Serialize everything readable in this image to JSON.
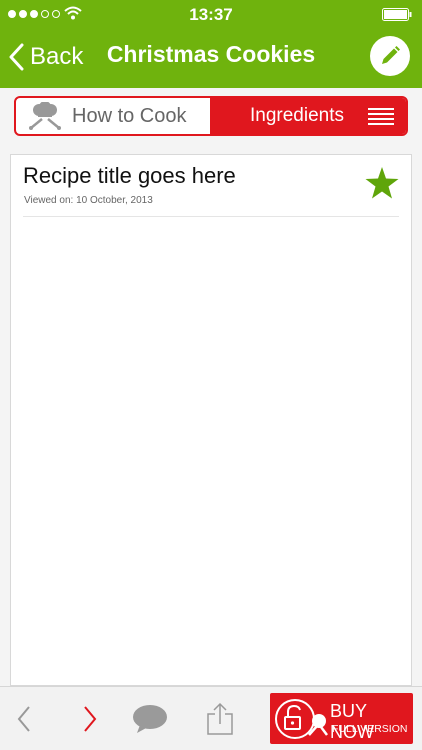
{
  "status_bar": {
    "time": "13:37",
    "signal_dots_filled": 3,
    "signal_dots_total": 5
  },
  "nav": {
    "back_label": "Back",
    "title": "Christmas Cookies"
  },
  "segment": {
    "left_label": "How to Cook",
    "right_label": "Ingredients",
    "selected": "Ingredients"
  },
  "recipe": {
    "title": "Recipe title goes here",
    "viewed": "Viewed on: 10 October, 2013",
    "favorited": true
  },
  "buy": {
    "label": "BUY NOW",
    "sub_label": "FULL VERSION"
  },
  "colors": {
    "header_green": "#6fb30d",
    "accent_red": "#e0171e",
    "star_green": "#5fa50a"
  },
  "icons": {
    "signal": "signal-dots-icon",
    "wifi": "wifi-icon",
    "battery": "battery-icon",
    "back": "chevron-left-icon",
    "edit": "pencil-icon",
    "chef": "chef-hat-icon",
    "menu": "hamburger-icon",
    "star": "star-icon",
    "prev": "chevron-left-icon",
    "next": "chevron-right-icon",
    "comment": "speech-bubble-icon",
    "share": "share-icon",
    "unlock": "unlock-icon"
  }
}
